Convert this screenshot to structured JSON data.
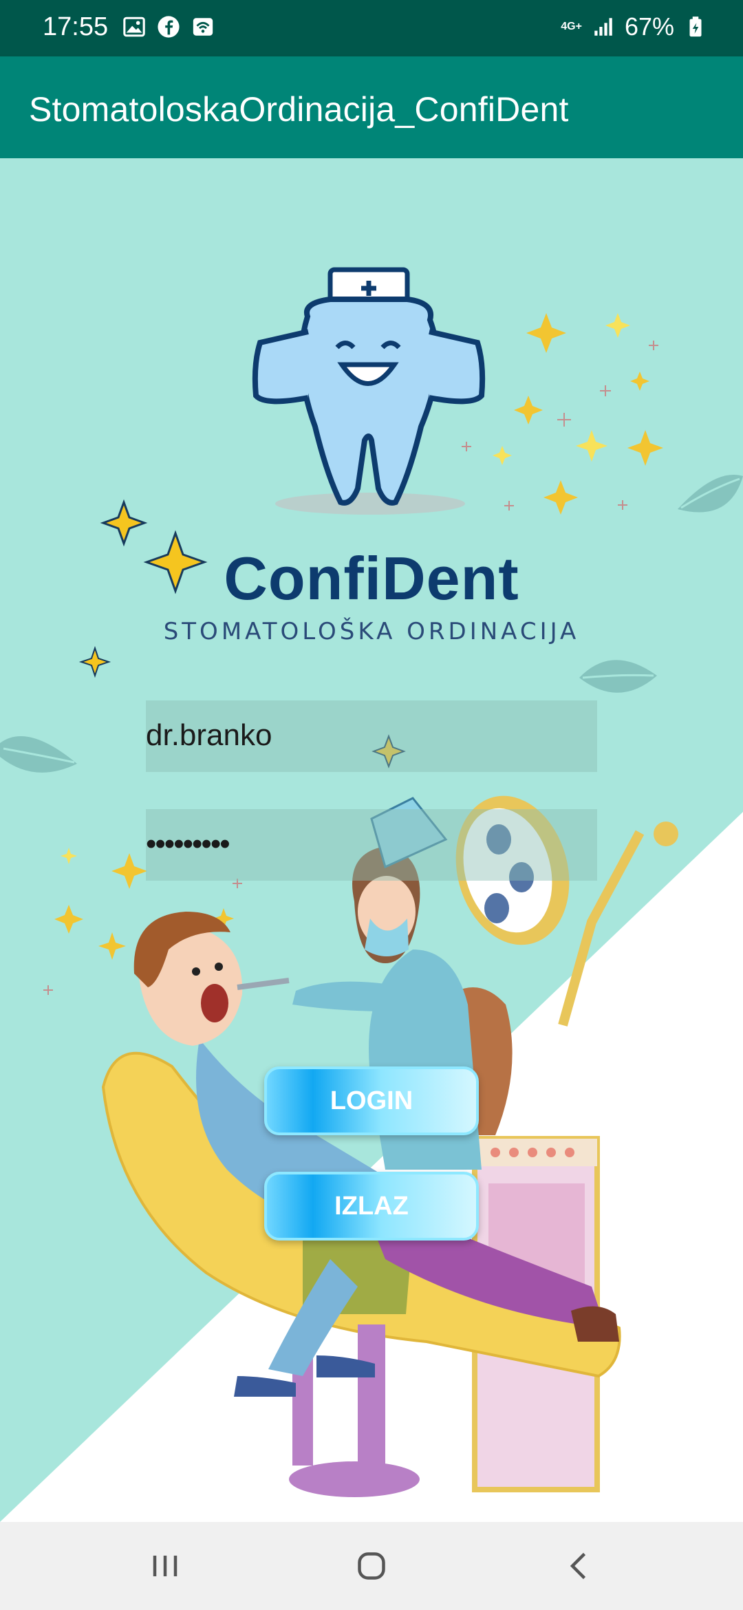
{
  "status_bar": {
    "time": "17:55",
    "network": "4G+",
    "battery": "67%",
    "icons_left": [
      "gallery-icon",
      "facebook-icon",
      "wifi-hotspot-icon"
    ],
    "icons_right": [
      "network-4g-icon",
      "signal-icon",
      "battery-icon"
    ]
  },
  "app_bar": {
    "title": "StomatoloskaOrdinacija_ConfiDent"
  },
  "logo": {
    "name": "ConfiDent",
    "subtitle": "STOMATOLOŠKA ORDINACIJA"
  },
  "form": {
    "username_value": "dr.branko",
    "password_value": "•••••••••"
  },
  "buttons": {
    "login": "LOGIN",
    "exit": "IZLAZ"
  },
  "nav_bar": {
    "items": [
      "recent-apps-icon",
      "home-icon",
      "back-icon"
    ]
  },
  "colors": {
    "status_bar": "#00574b",
    "app_bar": "#008577",
    "background_mint": "#a8e6dc",
    "brand_navy": "#0d3b6e",
    "button_blue": "#12a8f2"
  }
}
